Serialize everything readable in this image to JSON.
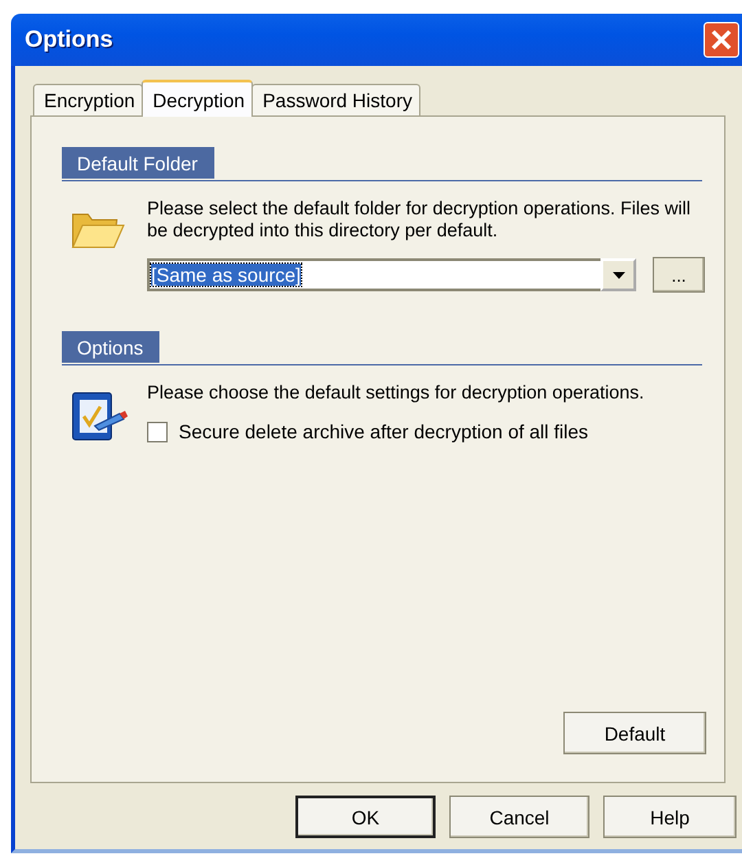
{
  "window": {
    "title": "Options"
  },
  "tabs": [
    {
      "label": "Encryption",
      "selected": false
    },
    {
      "label": "Decryption",
      "selected": true
    },
    {
      "label": "Password History",
      "selected": false
    }
  ],
  "sections": [
    {
      "kind": "folder",
      "heading": "Default Folder",
      "description": "Please select the default folder for decryption operations. Files will be decrypted into this directory per default.",
      "combo": {
        "value": "[Same as source]"
      },
      "browse_button": "..."
    },
    {
      "kind": "settings",
      "heading": "Options",
      "description": "Please choose the default settings for decryption operations.",
      "checkboxes": [
        {
          "label": "Secure delete archive after decryption of all files",
          "checked": false
        }
      ]
    }
  ],
  "default_button": "Default",
  "buttons": [
    "OK",
    "Cancel",
    "Help"
  ]
}
